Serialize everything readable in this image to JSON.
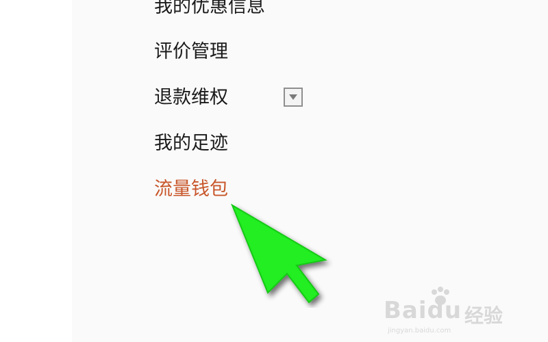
{
  "menu": {
    "items": [
      {
        "label": "我的优惠信息"
      },
      {
        "label": "评价管理"
      },
      {
        "label": "退款维权"
      },
      {
        "label": "我的足迹"
      },
      {
        "label": "流量钱包"
      }
    ],
    "active_index": 4,
    "active_color": "#c8562a",
    "text_color": "#1a1a1a",
    "dropdown_icon": "triangle-down-icon"
  },
  "cursor": {
    "icon": "pointer-arrow-icon",
    "color": "#22ee22"
  },
  "watermark": {
    "brand": "Bai",
    "brand2": "du",
    "cn": "经验",
    "url": "jingyan.baidu.com",
    "icon": "paw-icon"
  }
}
